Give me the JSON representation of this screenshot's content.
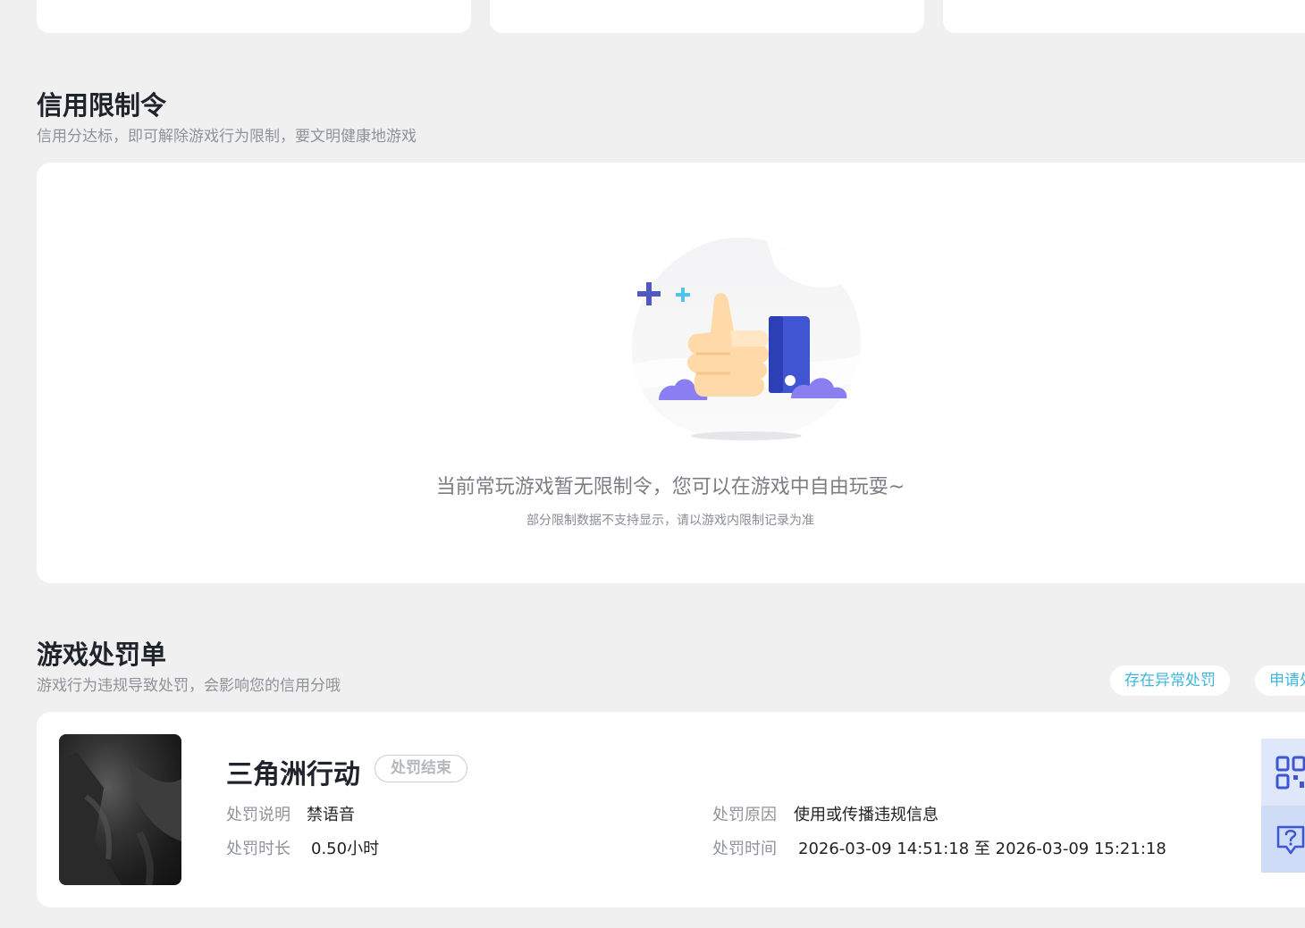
{
  "credit_restriction": {
    "title": "信用限制令",
    "subtitle": "信用分达标，即可解除游戏行为限制，要文明健康地游戏",
    "empty_message": "当前常玩游戏暂无限制令，您可以在游戏中自由玩耍~",
    "empty_note": "部分限制数据不支持显示，请以游戏内限制记录为准"
  },
  "penalty": {
    "title": "游戏处罚单",
    "subtitle": "游戏行为违规导致处罚，会影响您的信用分哦",
    "actions": [
      "存在异常处罚",
      "申请处"
    ]
  },
  "penalty_item": {
    "game_name": "三角洲行动",
    "status": "处罚结束",
    "desc_label": "处罚说明",
    "desc_value": "禁语音",
    "duration_label": "处罚时长",
    "duration_value": "0.50小时",
    "reason_label": "处罚原因",
    "reason_value": "使用或传播违规信息",
    "time_label": "处罚时间",
    "time_value": "2026-03-09 14:51:18 至 2026-03-09 15:21:18"
  },
  "side_tools": {
    "qr": "qr-code-icon",
    "help": "help-chat-icon"
  },
  "colors": {
    "accent": "#3fb6da",
    "thumb_blue": "#3f55d1",
    "hand": "#ffd9a8",
    "cloud": "#8b7ef0"
  }
}
